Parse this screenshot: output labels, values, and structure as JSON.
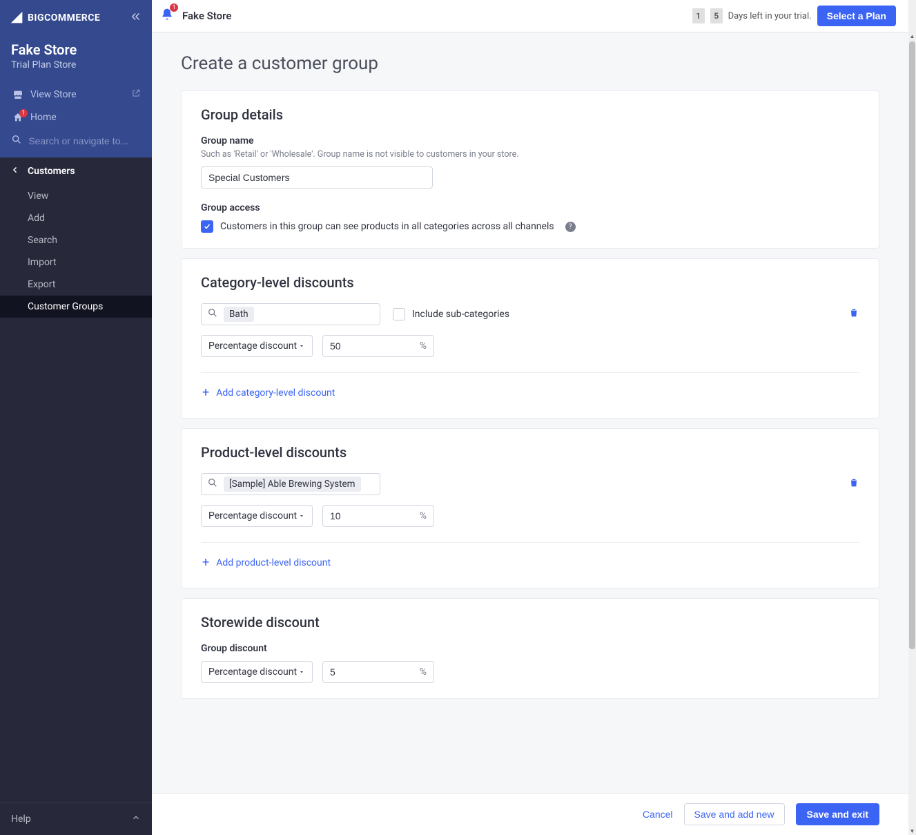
{
  "brand": {
    "name": "BIGCOMMERCE"
  },
  "store": {
    "name": "Fake Store",
    "plan": "Trial Plan Store"
  },
  "sidebar": {
    "view_store": "View Store",
    "home": "Home",
    "home_badge": "1",
    "search_placeholder": "Search or navigate to...",
    "section": "Customers",
    "items": [
      "View",
      "Add",
      "Search",
      "Import",
      "Export",
      "Customer Groups"
    ],
    "active_index": 5,
    "help": "Help"
  },
  "topbar": {
    "bell_badge": "1",
    "store_title": "Fake Store",
    "trial_digits": [
      "1",
      "5"
    ],
    "trial_text": "Days left in your trial.",
    "select_plan": "Select a Plan"
  },
  "page": {
    "title": "Create a customer group"
  },
  "group_details": {
    "heading": "Group details",
    "name_label": "Group name",
    "name_hint": "Such as 'Retail' or 'Wholesale'. Group name is not visible to customers in your store.",
    "name_value": "Special Customers",
    "access_label": "Group access",
    "access_checkbox_label": "Customers in this group can see products in all categories across all channels",
    "access_checked": true
  },
  "category_discounts": {
    "heading": "Category-level discounts",
    "chip": "Bath",
    "include_sub_label": "Include sub-categories",
    "include_sub_checked": false,
    "type": "Percentage discount",
    "amount": "50",
    "unit": "%",
    "add_label": "Add category-level discount"
  },
  "product_discounts": {
    "heading": "Product-level discounts",
    "chip": "[Sample] Able Brewing System",
    "type": "Percentage discount",
    "amount": "10",
    "unit": "%",
    "add_label": "Add product-level discount"
  },
  "storewide": {
    "heading": "Storewide discount",
    "label": "Group discount",
    "type": "Percentage discount",
    "amount": "5",
    "unit": "%"
  },
  "footer": {
    "cancel": "Cancel",
    "save_add_new": "Save and add new",
    "save_exit": "Save and exit"
  }
}
